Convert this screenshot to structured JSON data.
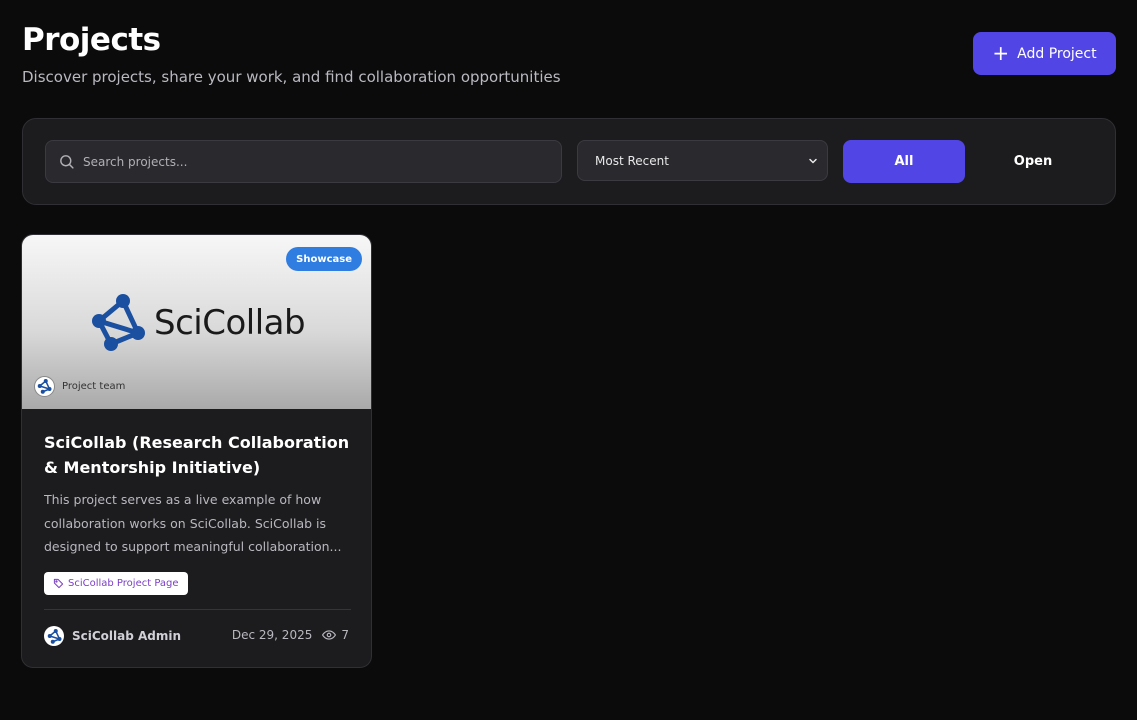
{
  "header": {
    "title": "Projects",
    "subtitle": "Discover projects, share your work, and find collaboration opportunities",
    "add_button": "Add Project"
  },
  "filters": {
    "search_placeholder": "Search projects...",
    "sort_selected": "Most Recent",
    "segments": [
      "All",
      "Open"
    ],
    "active_segment": "All"
  },
  "colors": {
    "accent": "#5146e5",
    "badge": "#2f7de1",
    "logo_blue": "#1b4fa0",
    "tag_text": "#7b3fc4"
  },
  "projects": [
    {
      "badge": "Showcase",
      "logo_text": "SciCollab",
      "team_label": "Project team",
      "title": "SciCollab (Research Collaboration & Mentorship Initiative)",
      "description": "This project serves as a live example of how collaboration works on SciCollab. SciCollab is designed to support meaningful collaboration...",
      "tag": "SciCollab Project Page",
      "author": "SciCollab Admin",
      "date": "Dec 29, 2025",
      "views": "7"
    }
  ]
}
